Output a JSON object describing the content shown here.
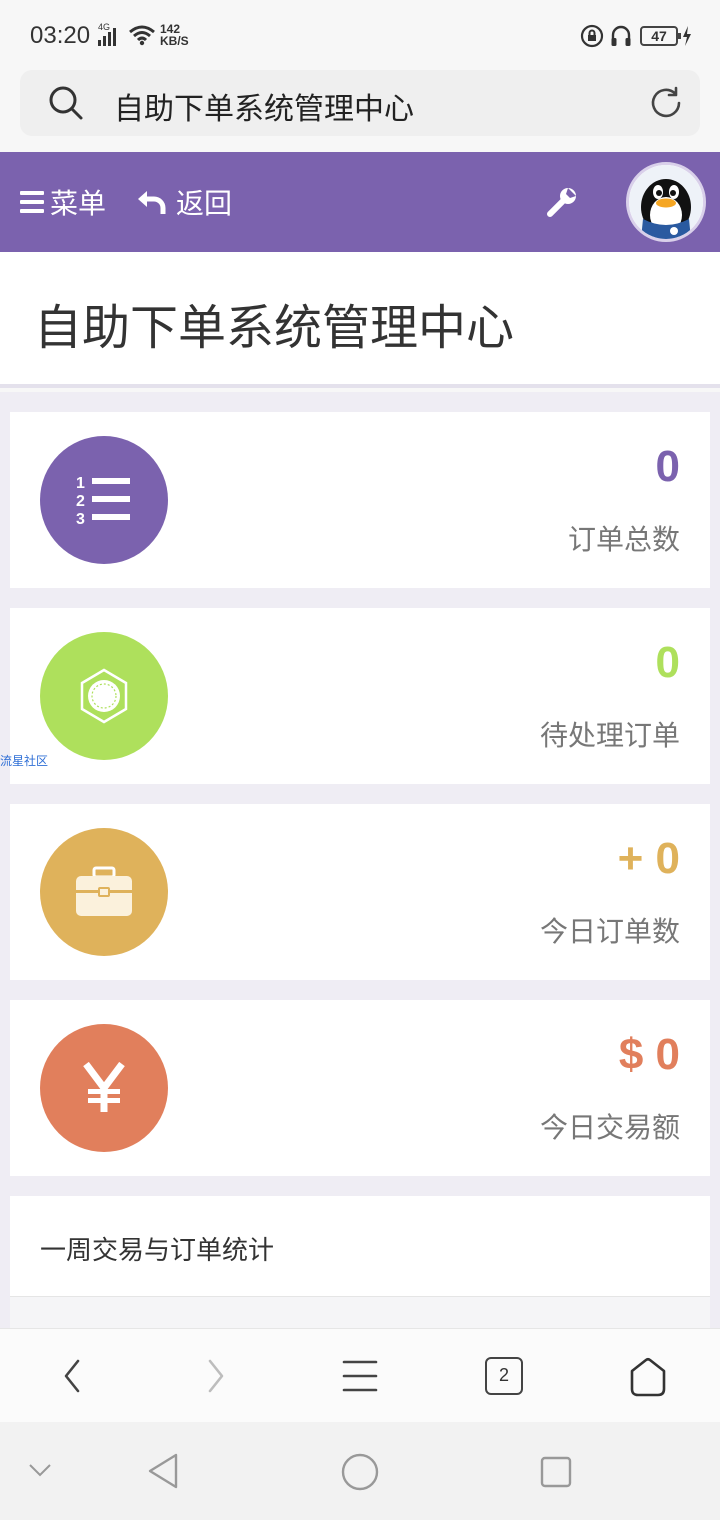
{
  "status_bar": {
    "time": "03:20",
    "network": "4G",
    "speed_value": "142",
    "speed_unit": "KB/S",
    "battery": "47"
  },
  "url_bar": {
    "title": "自助下单系统管理中心"
  },
  "header": {
    "menu_label": "菜单",
    "back_label": "返回"
  },
  "page": {
    "title": "自助下单系统管理中心"
  },
  "stats": [
    {
      "value": "0",
      "label": "订单总数",
      "icon": "ordered-list-icon",
      "color": "#7b62ae"
    },
    {
      "value": "0",
      "label": "待处理订单",
      "icon": "gear-badge-icon",
      "color": "#aee05c"
    },
    {
      "value": "+ 0",
      "label": "今日订单数",
      "icon": "briefcase-icon",
      "color": "#dfb25b"
    },
    {
      "value": "$ 0",
      "label": "今日交易额",
      "icon": "yen-icon",
      "color": "#e17f5c"
    }
  ],
  "watermark": "流星社区",
  "weekly": {
    "title": "一周交易与订单统计"
  },
  "browser_bar": {
    "tab_count": "2"
  }
}
